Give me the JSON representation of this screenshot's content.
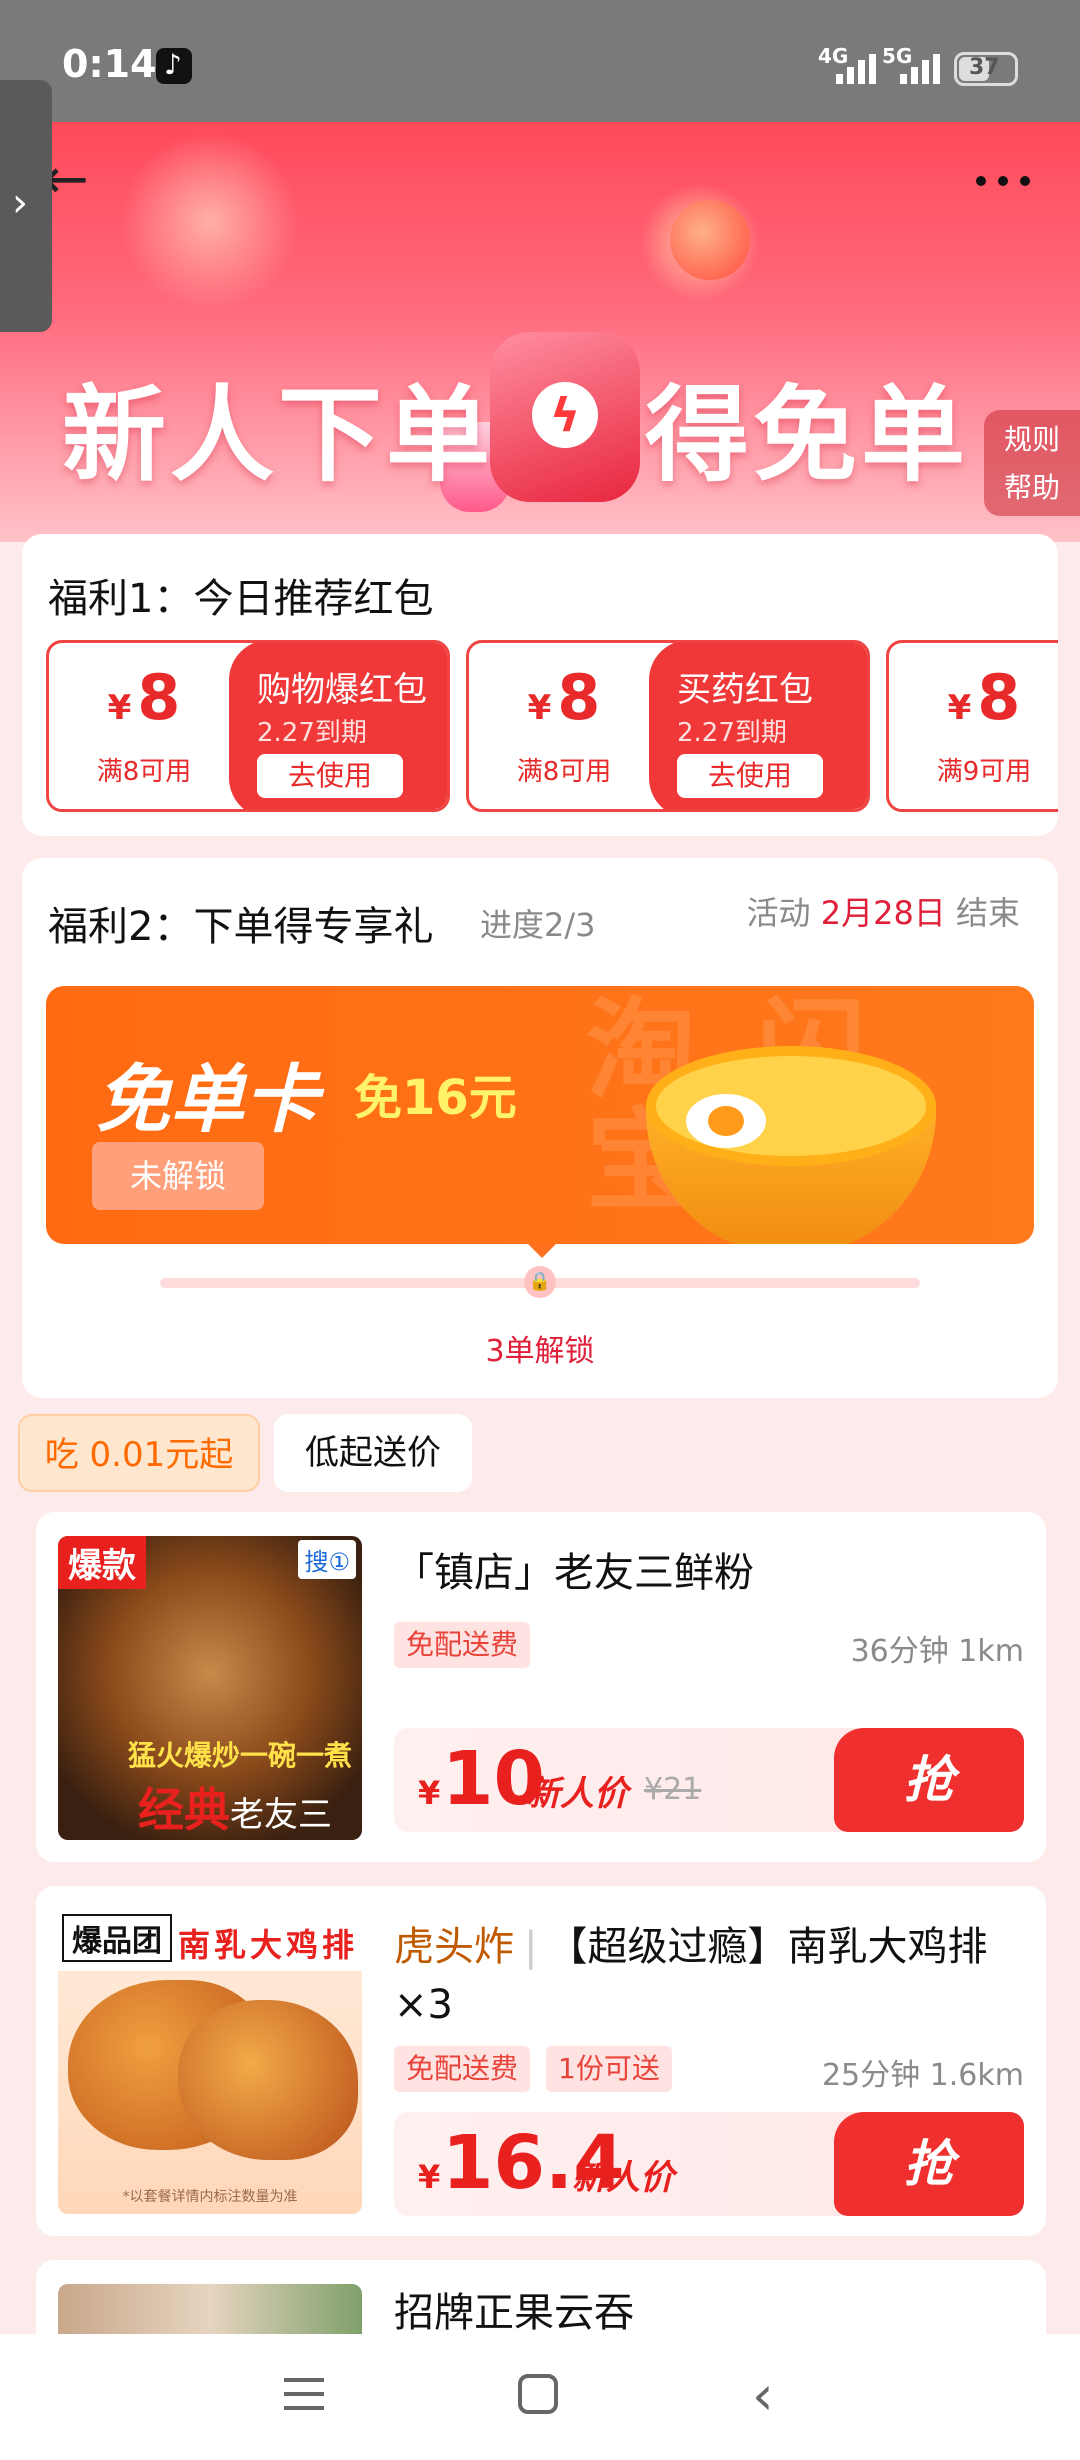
{
  "status_bar": {
    "time": "0:14",
    "network_1": "4G",
    "network_2": "5G",
    "battery": "37"
  },
  "banner": {
    "title_left": "新人下单",
    "title_right": "得免单",
    "rules_line1": "规则",
    "rules_line2": "帮助"
  },
  "benefit1": {
    "title": "福利1：今日推荐红包",
    "coupons": [
      {
        "currency": "¥",
        "amount": "8",
        "condition": "满8可用",
        "name": "购物爆红包",
        "expiry": "2.27到期",
        "action": "去使用"
      },
      {
        "currency": "¥",
        "amount": "8",
        "condition": "满8可用",
        "name": "买药红包",
        "expiry": "2.27到期",
        "action": "去使用"
      },
      {
        "currency": "¥",
        "amount": "8",
        "condition": "满9可用"
      }
    ]
  },
  "benefit2": {
    "title": "福利2：下单得专享礼",
    "progress": "进度2/3",
    "activity_prefix": "活动",
    "activity_date": "2月28日",
    "activity_suffix": "结束",
    "card_title": "免单卡",
    "card_amount": "免16元",
    "card_status": "未解锁",
    "watermark": "淘闪宝购",
    "unlock_text": "3单解锁"
  },
  "filters": {
    "chip1": "吃 0.01元起",
    "chip2": "低起送价"
  },
  "items": [
    {
      "thumb_tag": "爆款",
      "thumb_logo": "搜①",
      "thumb_slogan": "猛火爆炒一碗一煮",
      "thumb_name_big": "经典",
      "thumb_name": "老友三鲜粉",
      "title": "「镇店」老友三鲜粉",
      "badges": [
        "免配送费"
      ],
      "eta": "36分钟 1km",
      "currency": "¥",
      "price": "10",
      "price_label": "新人价",
      "old_price": "¥21",
      "action": "抢"
    },
    {
      "thumb_tag": "爆品团",
      "thumb_title": "南乳大鸡排",
      "thumb_note": "*以套餐详情内标注数量为准",
      "brand": "虎头炸",
      "title": "【超级过瘾】南乳大鸡排×3",
      "badges": [
        "免配送费",
        "1份可送"
      ],
      "eta": "25分钟 1.6km",
      "currency": "¥",
      "price": "16.4",
      "price_label": "新人价",
      "action": "抢"
    },
    {
      "title": "招牌正果云吞"
    }
  ],
  "colors": {
    "accent": "#f0302e",
    "orange": "#ff6a12",
    "page_bg": "#fdeaea"
  }
}
